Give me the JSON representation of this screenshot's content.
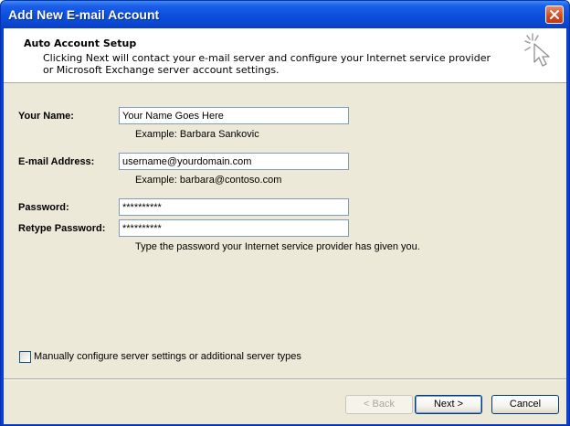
{
  "window": {
    "title": "Add New E-mail Account",
    "close_icon": "close-icon"
  },
  "header": {
    "title": "Auto Account Setup",
    "description": "Clicking Next will contact your e-mail server and configure your Internet service provider or Microsoft Exchange server account settings.",
    "icon": "wizard-cursor-icon"
  },
  "form": {
    "name_label": "Your Name:",
    "name_value": "Your Name Goes Here",
    "name_hint": "Example: Barbara Sankovic",
    "email_label": "E-mail Address:",
    "email_value": "username@yourdomain.com",
    "email_hint": "Example: barbara@contoso.com",
    "password_label": "Password:",
    "password_value": "**********",
    "retype_label": "Retype Password:",
    "retype_value": "**********",
    "password_hint": "Type the password your Internet service provider has given you."
  },
  "manual_config": {
    "label": "Manually configure server settings or additional server types",
    "checked": false
  },
  "buttons": {
    "back": "< Back",
    "next": "Next >",
    "cancel": "Cancel"
  },
  "colors": {
    "title_bar": "#0a4fdc",
    "dialog_bg": "#ece9d8",
    "close_button": "#d2481f"
  }
}
